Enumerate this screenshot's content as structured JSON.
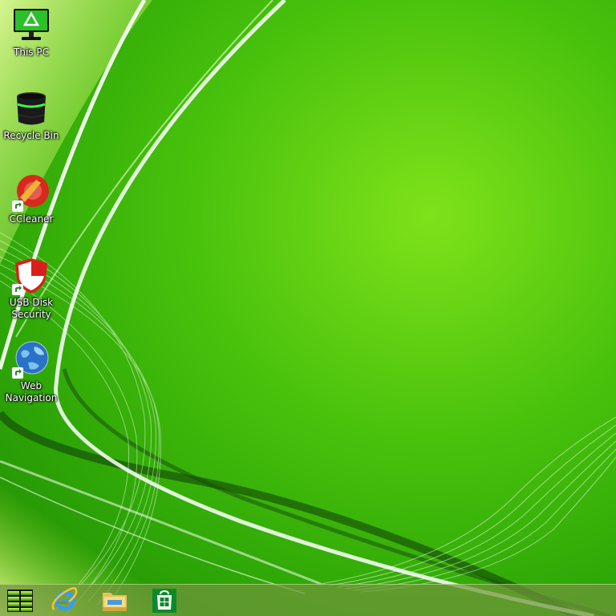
{
  "desktop": {
    "icons": [
      {
        "label": "This PC",
        "icon": "monitor-icon"
      },
      {
        "label": "Recycle Bin",
        "icon": "recycle-bin-icon"
      },
      {
        "label": "CCleaner",
        "icon": "ccleaner-icon"
      },
      {
        "label": "USB Disk\nSecurity",
        "icon": "shield-icon"
      },
      {
        "label": "Web\nNavigation",
        "icon": "globe-icon"
      }
    ]
  },
  "taskbar": {
    "items": [
      {
        "icon": "windows-start-icon"
      },
      {
        "icon": "internet-explorer-icon"
      },
      {
        "icon": "file-explorer-icon"
      },
      {
        "icon": "store-icon"
      }
    ]
  },
  "colors": {
    "wallpaper_green": "#48c10c",
    "taskbar": "#70963c"
  }
}
